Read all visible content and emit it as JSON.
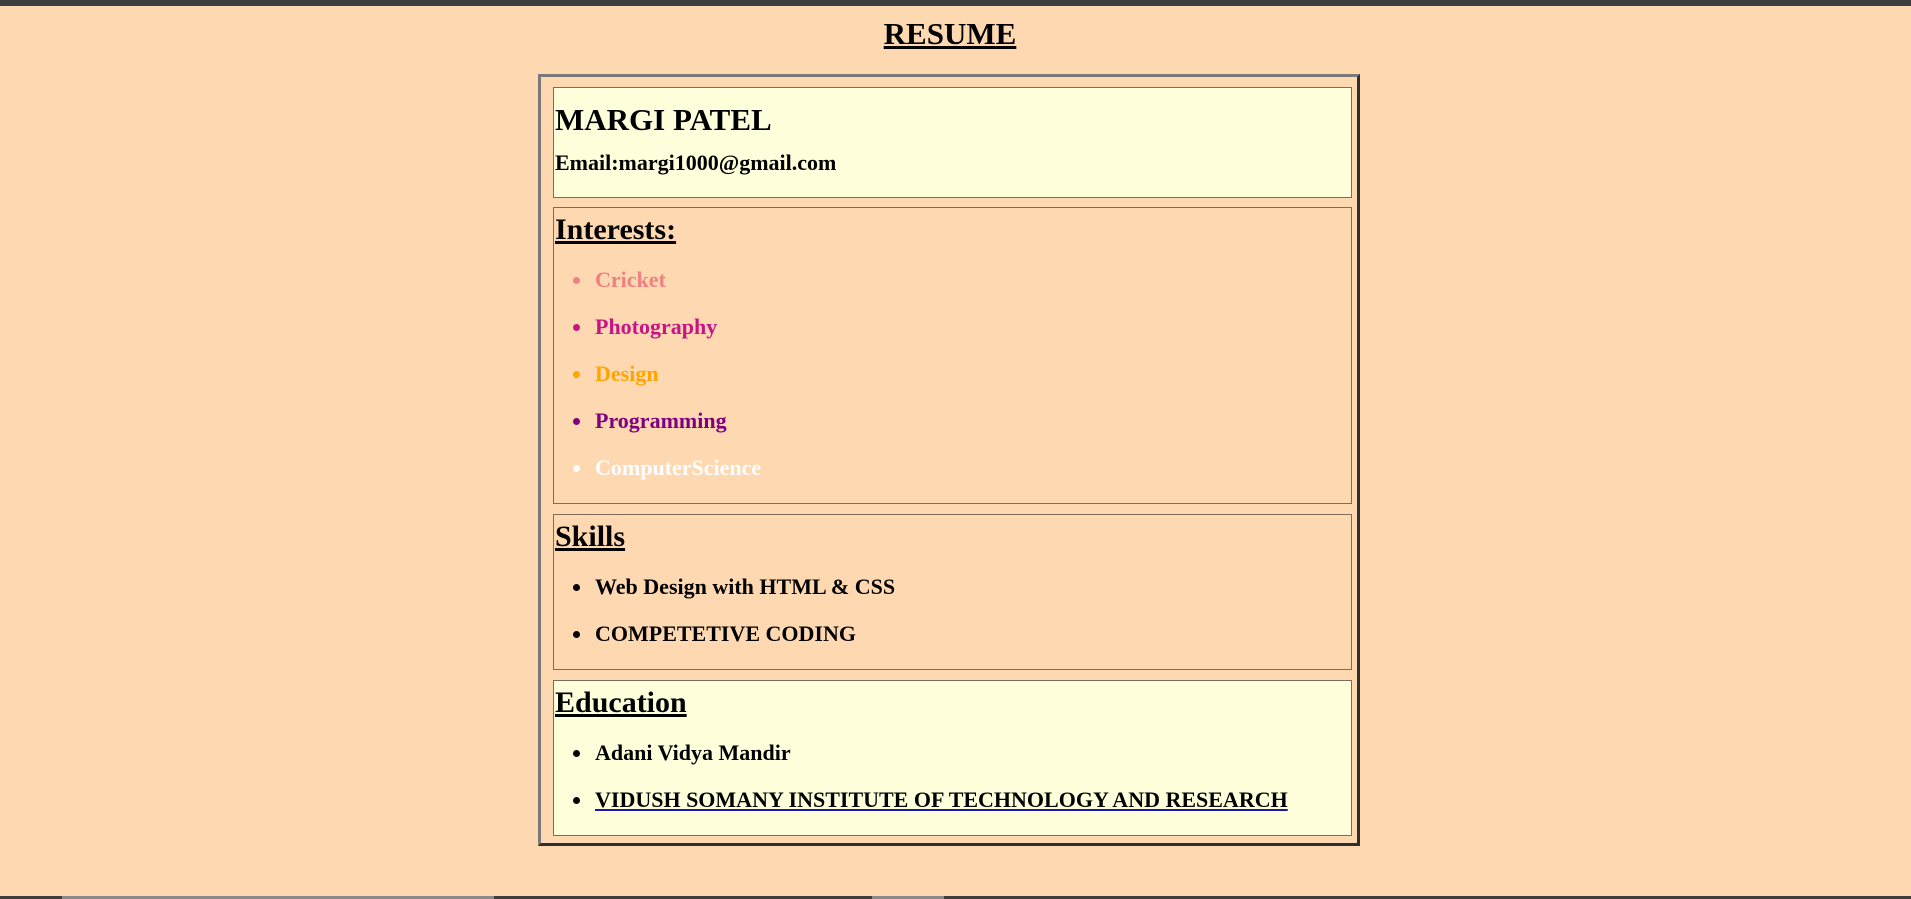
{
  "page": {
    "title": "RESUME"
  },
  "header": {
    "name": "MARGI PATEL",
    "email": "Email:margi1000@gmail.com"
  },
  "interests": {
    "heading": "Interests:",
    "items": [
      {
        "label": "Cricket",
        "color": "#f08080"
      },
      {
        "label": "Photography",
        "color": "#c71585"
      },
      {
        "label": "Design",
        "color": "#ffa500"
      },
      {
        "label": "Programming",
        "color": "#800080"
      },
      {
        "label": "ComputerScience",
        "color": "#ffffff"
      }
    ]
  },
  "skills": {
    "heading": "Skills",
    "items": [
      {
        "label": "Web Design with HTML & CSS"
      },
      {
        "label": "COMPETETIVE CODING"
      }
    ]
  },
  "education": {
    "heading": "Education",
    "items": [
      {
        "label": "Adani Vidya Mandir"
      },
      {
        "label": "VIDUSH SOMANY INSTITUTE OF TECHNOLOGY AND RESEARCH",
        "is_link": true
      }
    ]
  },
  "colors": {
    "page_background": "#fed8b1",
    "cream_section": "#ffffdc",
    "peach_section": "#fed8b1",
    "text": "#000000"
  }
}
